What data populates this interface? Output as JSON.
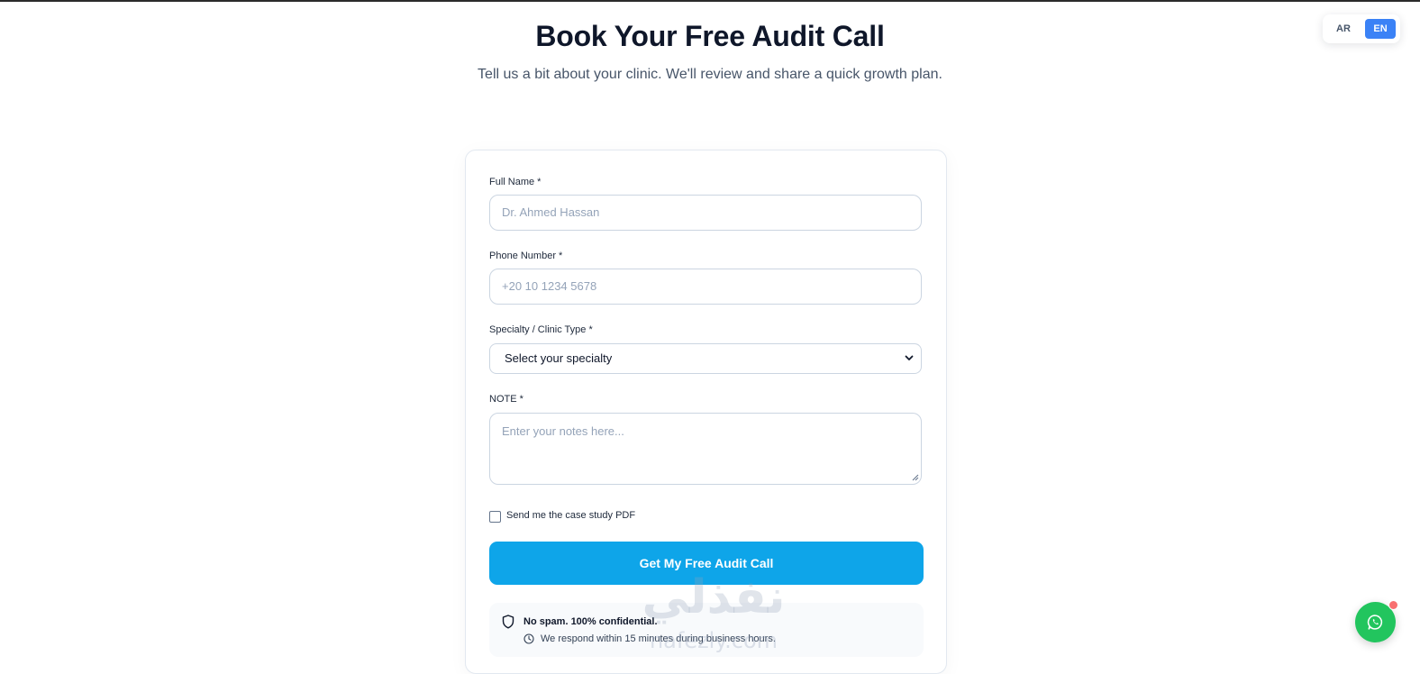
{
  "hero": {
    "title": "Book Your Free Audit Call",
    "subtitle": "Tell us a bit about your clinic. We'll review and share a quick growth plan."
  },
  "lang": {
    "ar": "AR",
    "en": "EN",
    "active": "EN"
  },
  "form": {
    "full_name": {
      "label": "Full Name *",
      "placeholder": "Dr. Ahmed Hassan"
    },
    "phone": {
      "label": "Phone Number *",
      "placeholder": "+20 10 1234 5678"
    },
    "specialty": {
      "label": "Specialty / Clinic Type *",
      "selected": "Select your specialty"
    },
    "note": {
      "label": "NOTE *",
      "placeholder": "Enter your notes here..."
    },
    "checkbox_label": "Send me the case study PDF",
    "checkbox_checked": false,
    "submit_label": "Get My Free Audit Call"
  },
  "trust": {
    "line1": "No spam. 100% confidential.",
    "line2": "We respond within 15 minutes during business hours."
  },
  "watermark": {
    "script": "نفذلي",
    "latin": "nafezly.com"
  },
  "colors": {
    "accent": "#0ea5e9",
    "lang_active": "#3b82f6",
    "whatsapp": "#22c55e",
    "badge": "#f87171"
  },
  "icons": [
    "shield-icon",
    "clock-icon",
    "chevron-down-icon",
    "whatsapp-icon"
  ]
}
